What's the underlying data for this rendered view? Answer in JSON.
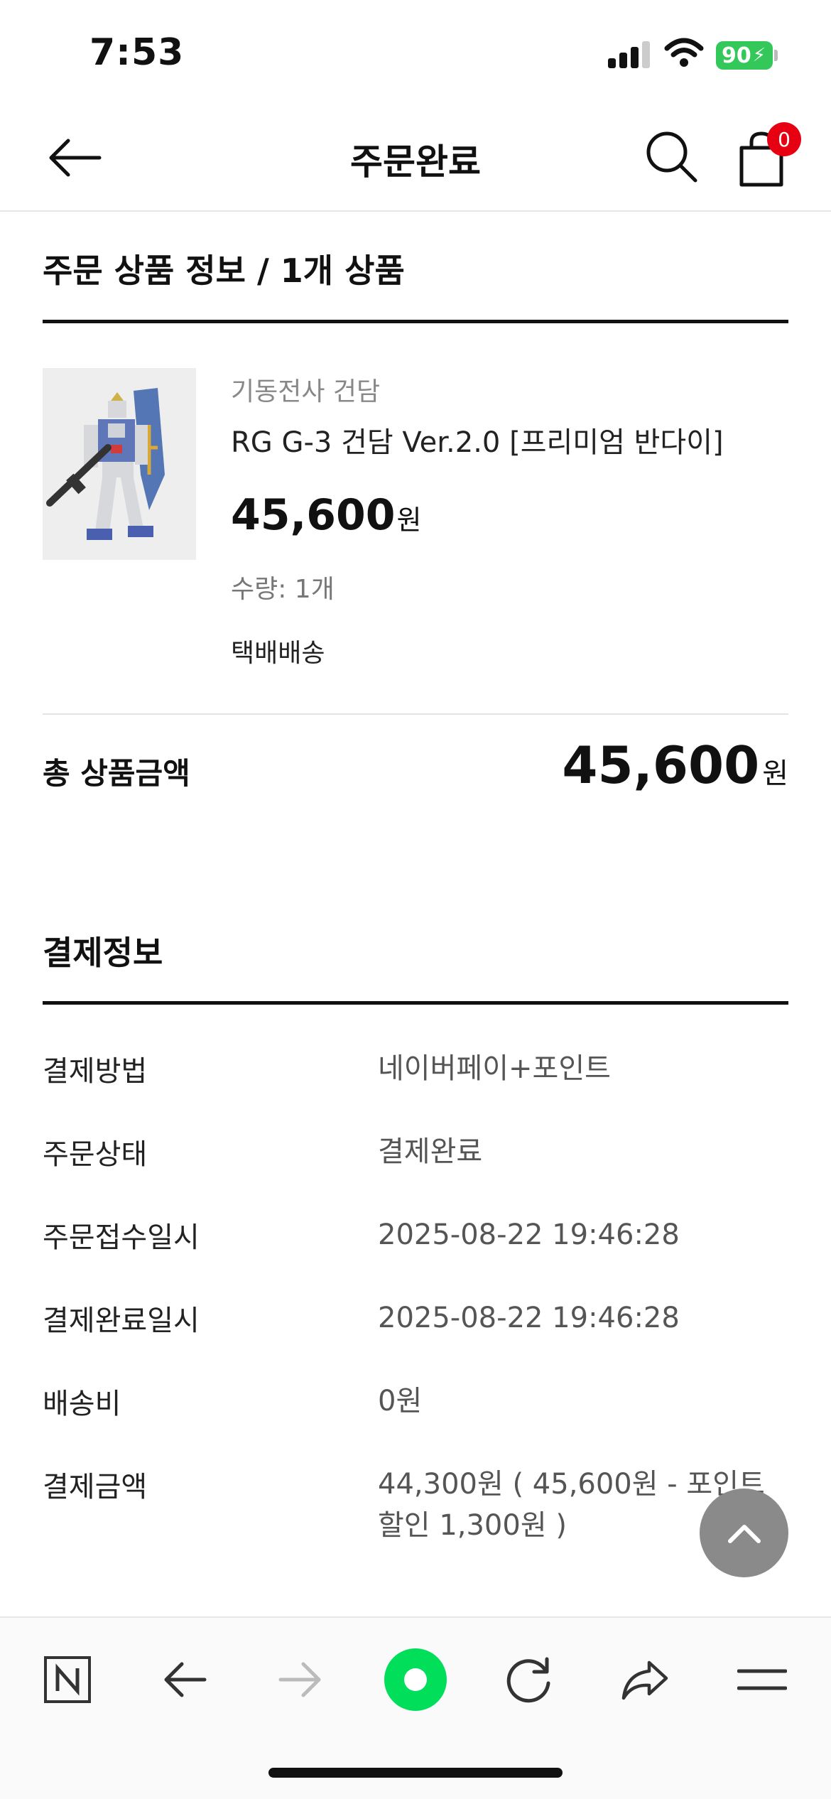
{
  "status_bar": {
    "time": "7:53",
    "battery": "90"
  },
  "header": {
    "title": "주문완료",
    "cart_count": "0"
  },
  "order": {
    "section_title": "주문 상품 정보 / 1개 상품",
    "product": {
      "brand": "기동전사 건담",
      "name": "RG G-3 건담 Ver.2.0 [프리미엄 반다이]",
      "price": "45,600",
      "price_unit": "원",
      "quantity": "수량: 1개",
      "shipping_type": "택배배송"
    },
    "total_label": "총 상품금액",
    "total_value": "45,600",
    "total_unit": "원"
  },
  "payment": {
    "section_title": "결제정보",
    "rows": [
      {
        "label": "결제방법",
        "value": "네이버페이+포인트"
      },
      {
        "label": "주문상태",
        "value": "결제완료"
      },
      {
        "label": "주문접수일시",
        "value": "2025-08-22 19:46:28"
      },
      {
        "label": "결제완료일시",
        "value": "2025-08-22 19:46:28"
      },
      {
        "label": "배송비",
        "value": "0원"
      },
      {
        "label": "결제금액",
        "value": "44,300원 ( 45,600원 - 포인트 할인 1,300원 )"
      }
    ]
  },
  "toolbar": {
    "icons": [
      "naver-icon",
      "back-arrow-icon",
      "forward-arrow-icon",
      "green-dot-icon",
      "refresh-icon",
      "share-icon",
      "menu-icon"
    ]
  },
  "colors": {
    "accent_green": "#00de5a",
    "badge_red": "#e60012",
    "battery_green": "#34c759"
  }
}
